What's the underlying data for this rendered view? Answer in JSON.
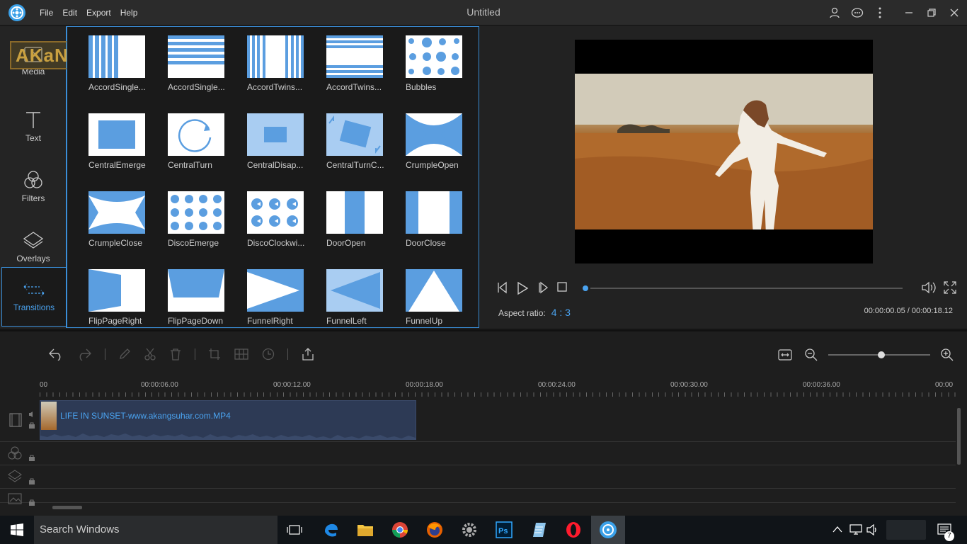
{
  "app": {
    "title": "Untitled",
    "menu": [
      "File",
      "Edit",
      "Export",
      "Help"
    ]
  },
  "sidebar": {
    "watermark": "AKaNGSUHAR",
    "items": [
      {
        "label": "Media",
        "icon": "media-icon"
      },
      {
        "label": "Text",
        "icon": "text-icon"
      },
      {
        "label": "Filters",
        "icon": "filters-icon"
      },
      {
        "label": "Overlays",
        "icon": "overlays-icon"
      },
      {
        "label": "Transitions",
        "icon": "transitions-icon"
      }
    ]
  },
  "transitions": [
    "AccordSingle...",
    "AccordSingle...",
    "AccordTwins...",
    "AccordTwins...",
    "Bubbles",
    "CentralEmerge",
    "CentralTurn",
    "CentralDisap...",
    "CentralTurnC...",
    "CrumpleOpen",
    "CrumpleClose",
    "DiscoEmerge",
    "DiscoClockwi...",
    "DoorOpen",
    "DoorClose",
    "FlipPageRight",
    "FlipPageDown",
    "FunnelRight",
    "FunnelLeft",
    "FunnelUp"
  ],
  "preview": {
    "aspect_label": "Aspect ratio:",
    "aspect_value": "4 : 3",
    "time": "00:00:00.05 / 00:00:18.12",
    "progress": 0.003
  },
  "timeline": {
    "ruler": [
      "00",
      "00:00:06.00",
      "00:00:12.00",
      "00:00:18.00",
      "00:00:24.00",
      "00:00:30.00",
      "00:00:36.00",
      "00:00"
    ],
    "clip_name": "LIFE IN SUNSET-www.akangsuhar.com.MP4"
  },
  "taskbar": {
    "search_placeholder": "Search Windows",
    "notification_count": "7"
  },
  "colors": {
    "accent": "#4aa3f0",
    "thumb_blue": "#5b9ee0",
    "panel_border": "#3a8ed8"
  }
}
